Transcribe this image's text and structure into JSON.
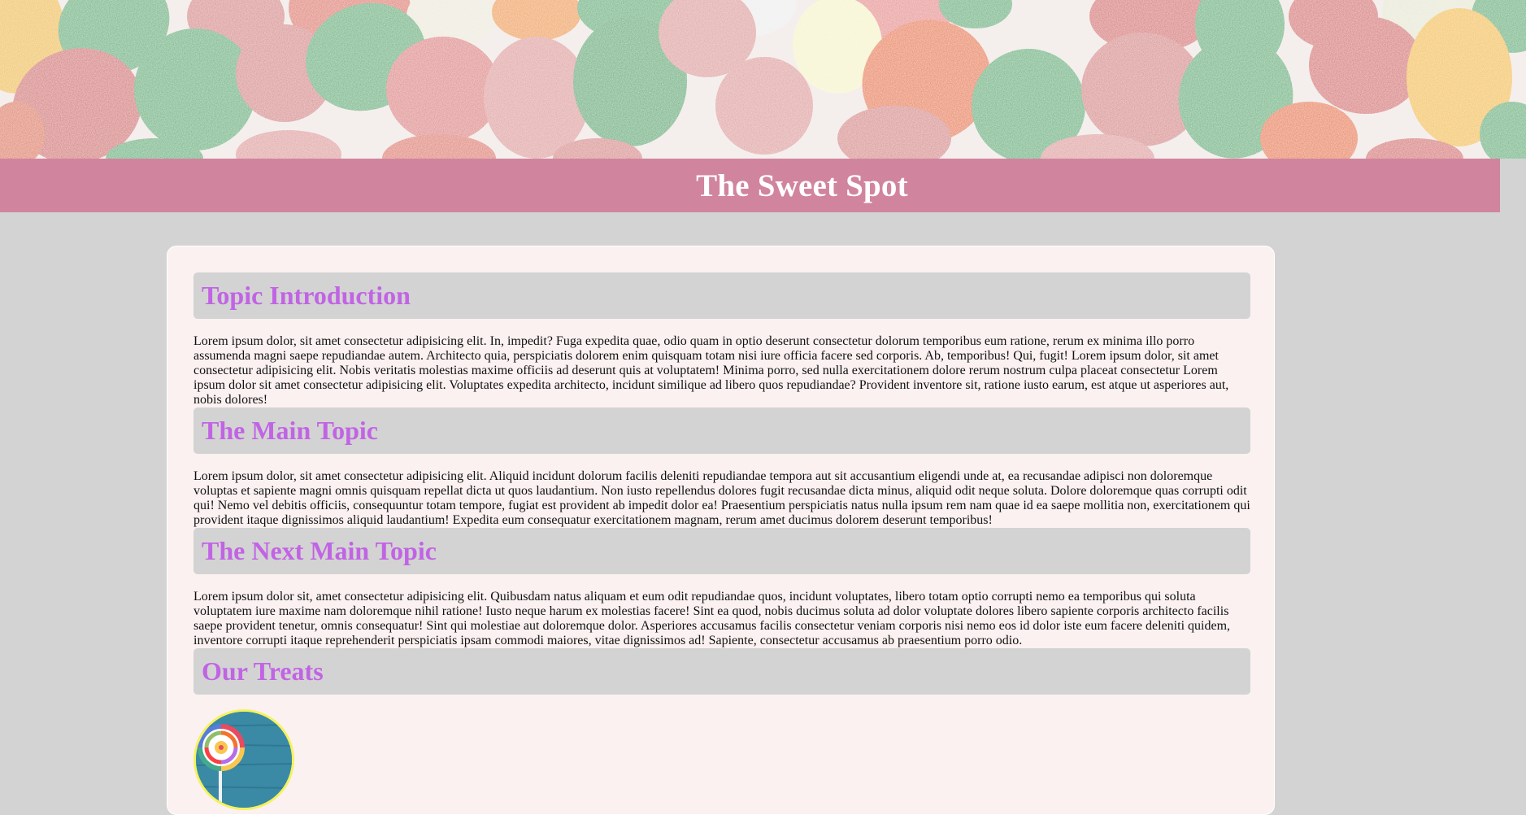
{
  "hero": {
    "icon": "candy-banner-image"
  },
  "site": {
    "title": "The Sweet Spot"
  },
  "sections": [
    {
      "heading": "Topic Introduction",
      "text": "Lorem ipsum dolor, sit amet consectetur adipisicing elit. In, impedit? Fuga expedita quae, odio quam in optio deserunt consectetur dolorum temporibus eum ratione, rerum ex minima illo porro assumenda magni saepe repudiandae autem. Architecto quia, perspiciatis dolorem enim quisquam totam nisi iure officia facere sed corporis. Ab, temporibus! Qui, fugit! Lorem ipsum dolor, sit amet consectetur adipisicing elit. Nobis veritatis molestias maxime officiis ad deserunt quis at voluptatem! Minima porro, sed nulla exercitationem dolore rerum nostrum culpa placeat consectetur Lorem ipsum dolor sit amet consectetur adipisicing elit. Voluptates expedita architecto, incidunt similique ad libero quos repudiandae? Provident inventore sit, ratione iusto earum, est atque ut asperiores aut, nobis dolores!"
    },
    {
      "heading": "The Main Topic",
      "text": "Lorem ipsum dolor, sit amet consectetur adipisicing elit. Aliquid incidunt dolorum facilis deleniti repudiandae tempora aut sit accusantium eligendi unde at, ea recusandae adipisci non doloremque voluptas et sapiente magni omnis quisquam repellat dicta ut quos laudantium. Non iusto repellendus dolores fugit recusandae dicta minus, aliquid odit neque soluta. Dolore doloremque quas corrupti odit qui! Nemo vel debitis officiis, consequuntur totam tempore, fugiat est provident ab impedit dolor ea! Praesentium perspiciatis natus nulla ipsum rem nam quae id ea saepe mollitia non, exercitationem qui provident itaque dignissimos aliquid laudantium! Expedita eum consequatur exercitationem magnam, rerum amet ducimus dolorem deserunt temporibus!"
    },
    {
      "heading": "The Next Main Topic",
      "text": "Lorem ipsum dolor sit, amet consectetur adipisicing elit. Quibusdam natus aliquam et eum odit repudiandae quos, incidunt voluptates, libero totam optio corrupti nemo ea temporibus qui soluta voluptatem iure maxime nam doloremque nihil ratione! Iusto neque harum ex molestias facere! Sint ea quod, nobis ducimus soluta ad dolor voluptate dolores libero sapiente corporis architecto facilis saepe provident tenetur, omnis consequatur! Sint qui molestiae aut doloremque dolor. Asperiores accusamus facilis consectetur veniam corporis nisi nemo eos id dolor iste eum facere deleniti quidem, inventore corrupti itaque reprehenderit perspiciatis ipsam commodi maiores, vitae dignissimos ad! Sapiente, consectetur accusamus ab praesentium porro odio."
    },
    {
      "heading": "Our Treats",
      "text": ""
    }
  ],
  "treats": [
    {
      "icon": "lollipop-icon"
    }
  ],
  "colors": {
    "page_bg": "#d3d3d3",
    "title_bar": "#d1849e",
    "heading_text": "#c164e4",
    "card_bg": "#fbf1f1",
    "treat_border": "#f6f25c"
  }
}
